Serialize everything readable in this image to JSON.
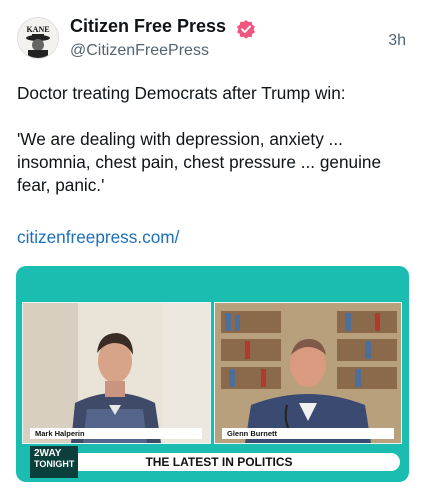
{
  "author": {
    "name": "Citizen Free Press",
    "handle": "@CitizenFreePress",
    "avatar_text": "KANE"
  },
  "post": {
    "time": "3h",
    "text": "Doctor treating Democrats after Trump win:\n\n'We are dealing with depression, anxiety ... insomnia, chest pain, chest pressure ... genuine fear, panic.'",
    "link": "citizenfreepress.com/"
  },
  "media": {
    "left_nameplate": "Mark Halperin",
    "right_nameplate": "Glenn Burnett",
    "logo_line1": "2WAY",
    "logo_line2": "TONIGHT",
    "banner": "THE LATEST IN POLITICS"
  },
  "colors": {
    "verified": "#f2557e",
    "link": "#1d70b8",
    "media_bg": "#1bbdb0"
  }
}
